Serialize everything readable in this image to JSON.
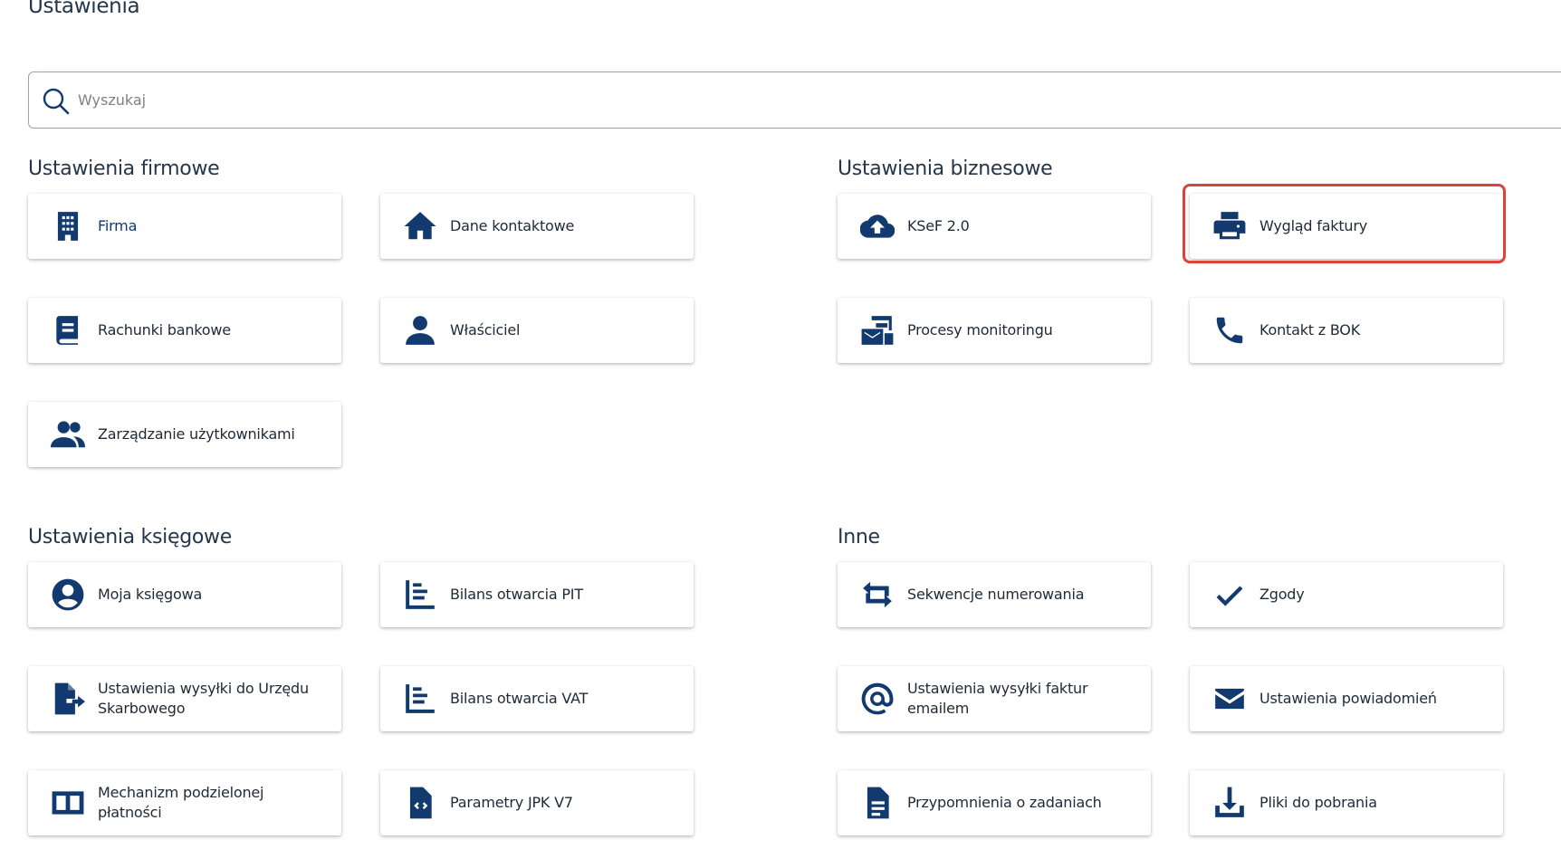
{
  "page": {
    "title": "Ustawienia"
  },
  "search": {
    "placeholder": "Wyszukaj",
    "icon": "search-icon"
  },
  "accent_color": "#123a6e",
  "highlight_color": "#d9453a",
  "sections": {
    "firmowe": {
      "title": "Ustawienia firmowe",
      "items": [
        {
          "label": "Firma",
          "icon": "building-icon"
        },
        {
          "label": "Dane kontaktowe",
          "icon": "home-icon"
        },
        {
          "label": "Rachunki bankowe",
          "icon": "book-icon"
        },
        {
          "label": "Właściciel",
          "icon": "person-icon"
        },
        {
          "label": "Zarządzanie użytkownikami",
          "icon": "users-icon"
        }
      ]
    },
    "biznesowe": {
      "title": "Ustawienia biznesowe",
      "items": [
        {
          "label": "KSeF 2.0",
          "icon": "cloud-upload-icon"
        },
        {
          "label": "Wygląd faktury",
          "icon": "printer-icon",
          "highlighted": true
        },
        {
          "label": "Procesy monitoringu",
          "icon": "monitoring-mail-icon"
        },
        {
          "label": "Kontakt z BOK",
          "icon": "phone-icon"
        }
      ]
    },
    "ksiegowe": {
      "title": "Ustawienia księgowe",
      "items": [
        {
          "label": "Moja księgowa",
          "icon": "account-circle-icon"
        },
        {
          "label": "Bilans otwarcia PIT",
          "icon": "balance-list-icon"
        },
        {
          "label": "Ustawienia wysyłki do Urzędu Skarbowego",
          "icon": "file-export-icon"
        },
        {
          "label": "Bilans otwarcia VAT",
          "icon": "balance-list-icon"
        },
        {
          "label": "Mechanizm podzielonej płatności",
          "icon": "split-columns-icon"
        },
        {
          "label": "Parametry JPK V7",
          "icon": "code-file-icon"
        }
      ]
    },
    "inne": {
      "title": "Inne",
      "items": [
        {
          "label": "Sekwencje numerowania",
          "icon": "repeat-icon"
        },
        {
          "label": "Zgody",
          "icon": "check-icon"
        },
        {
          "label": "Ustawienia wysyłki faktur emailem",
          "icon": "at-sign-icon"
        },
        {
          "label": "Ustawienia powiadomień",
          "icon": "envelope-icon"
        },
        {
          "label": "Przypomnienia o zadaniach",
          "icon": "document-icon"
        },
        {
          "label": "Pliki do pobrania",
          "icon": "download-icon"
        }
      ]
    }
  }
}
